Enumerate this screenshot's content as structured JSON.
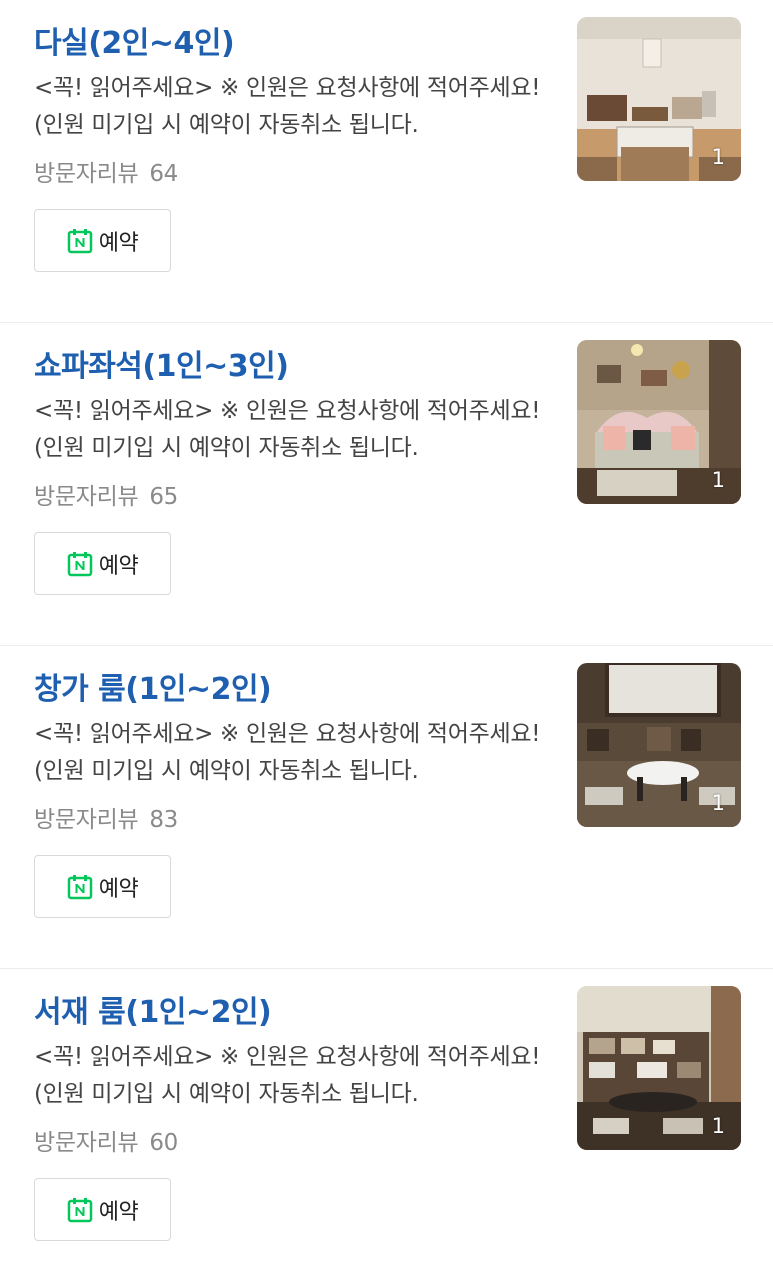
{
  "items": [
    {
      "title": "다실(2인~4인)",
      "description": "<꼭! 읽어주세요> ※ 인원은 요청사항에 적어주세요! (인원 미기입 시 예약이 자동취소 됩니다.",
      "review_label": "방문자리뷰",
      "review_count": "64",
      "reserve_label": "예약",
      "photo_count": "1"
    },
    {
      "title": "쇼파좌석(1인~3인)",
      "description": "<꼭! 읽어주세요> ※ 인원은 요청사항에 적어주세요! (인원 미기입 시 예약이 자동취소 됩니다.",
      "review_label": "방문자리뷰",
      "review_count": "65",
      "reserve_label": "예약",
      "photo_count": "1"
    },
    {
      "title": "창가 룸(1인~2인)",
      "description": "<꼭! 읽어주세요> ※ 인원은 요청사항에 적어주세요! (인원 미기입 시 예약이 자동취소 됩니다.",
      "review_label": "방문자리뷰",
      "review_count": "83",
      "reserve_label": "예약",
      "photo_count": "1"
    },
    {
      "title": "서재 룸(1인~2인)",
      "description": "<꼭! 읽어주세요> ※ 인원은 요청사항에 적어주세요! (인원 미기입 시 예약이 자동취소 됩니다.",
      "review_label": "방문자리뷰",
      "review_count": "60",
      "reserve_label": "예약",
      "photo_count": "1"
    }
  ],
  "colors": {
    "title": "#1e5fb0",
    "naver_green": "#03c75a"
  }
}
